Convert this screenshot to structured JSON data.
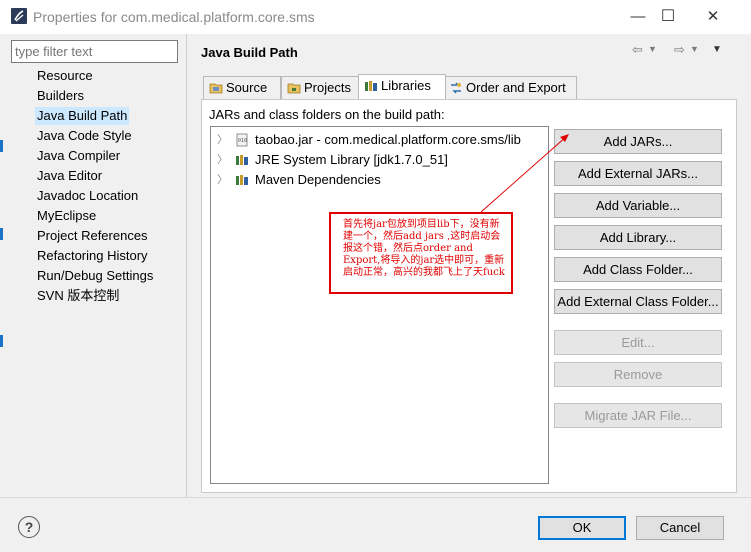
{
  "window": {
    "title": "Properties for com.medical.platform.core.sms",
    "minimize_glyph": "—",
    "maximize_glyph": "☐",
    "close_glyph": "✕"
  },
  "filter": {
    "placeholder": "type filter text"
  },
  "nav": {
    "items": [
      {
        "label": "Resource"
      },
      {
        "label": "Builders"
      },
      {
        "label": "Java Build Path",
        "selected": true
      },
      {
        "label": "Java Code Style"
      },
      {
        "label": "Java Compiler"
      },
      {
        "label": "Java Editor"
      },
      {
        "label": "Javadoc Location"
      },
      {
        "label": "MyEclipse"
      },
      {
        "label": "Project References"
      },
      {
        "label": "Refactoring History"
      },
      {
        "label": "Run/Debug Settings"
      },
      {
        "label": "SVN 版本控制"
      }
    ]
  },
  "page": {
    "title": "Java Build Path",
    "tabs": [
      {
        "label": "Source",
        "icon": "source-folder-icon"
      },
      {
        "label": "Projects",
        "icon": "projects-icon"
      },
      {
        "label": "Libraries",
        "icon": "libraries-icon",
        "active": true
      },
      {
        "label": "Order and Export",
        "icon": "order-export-icon"
      }
    ],
    "jars_label": "JARs and class folders on the build path:",
    "tree": [
      {
        "label": "taobao.jar - com.medical.platform.core.sms/lib",
        "icon": "jar-file-icon"
      },
      {
        "label": "JRE System Library [jdk1.7.0_51]",
        "icon": "library-icon"
      },
      {
        "label": "Maven Dependencies",
        "icon": "library-icon"
      }
    ],
    "buttons": [
      {
        "label": "Add JARs...",
        "enabled": true
      },
      {
        "label": "Add External JARs...",
        "enabled": true
      },
      {
        "label": "Add Variable...",
        "enabled": true
      },
      {
        "label": "Add Library...",
        "enabled": true
      },
      {
        "label": "Add Class Folder...",
        "enabled": true
      },
      {
        "label": "Add External Class Folder...",
        "enabled": true
      },
      {
        "label": "Edit...",
        "enabled": false
      },
      {
        "label": "Remove",
        "enabled": false
      },
      {
        "label": "Migrate JAR File...",
        "enabled": false
      }
    ]
  },
  "annotation": {
    "text": "首先将jar包放到项目lib下，没有新建一个，然后add jars ,这时启动会报这个错，然后点order and Export,将导入的jar选中即可，重新启动正常，高兴的我都飞上了天fuck",
    "color": "#e00000"
  },
  "footer": {
    "help_glyph": "?",
    "ok_label": "OK",
    "cancel_label": "Cancel"
  }
}
